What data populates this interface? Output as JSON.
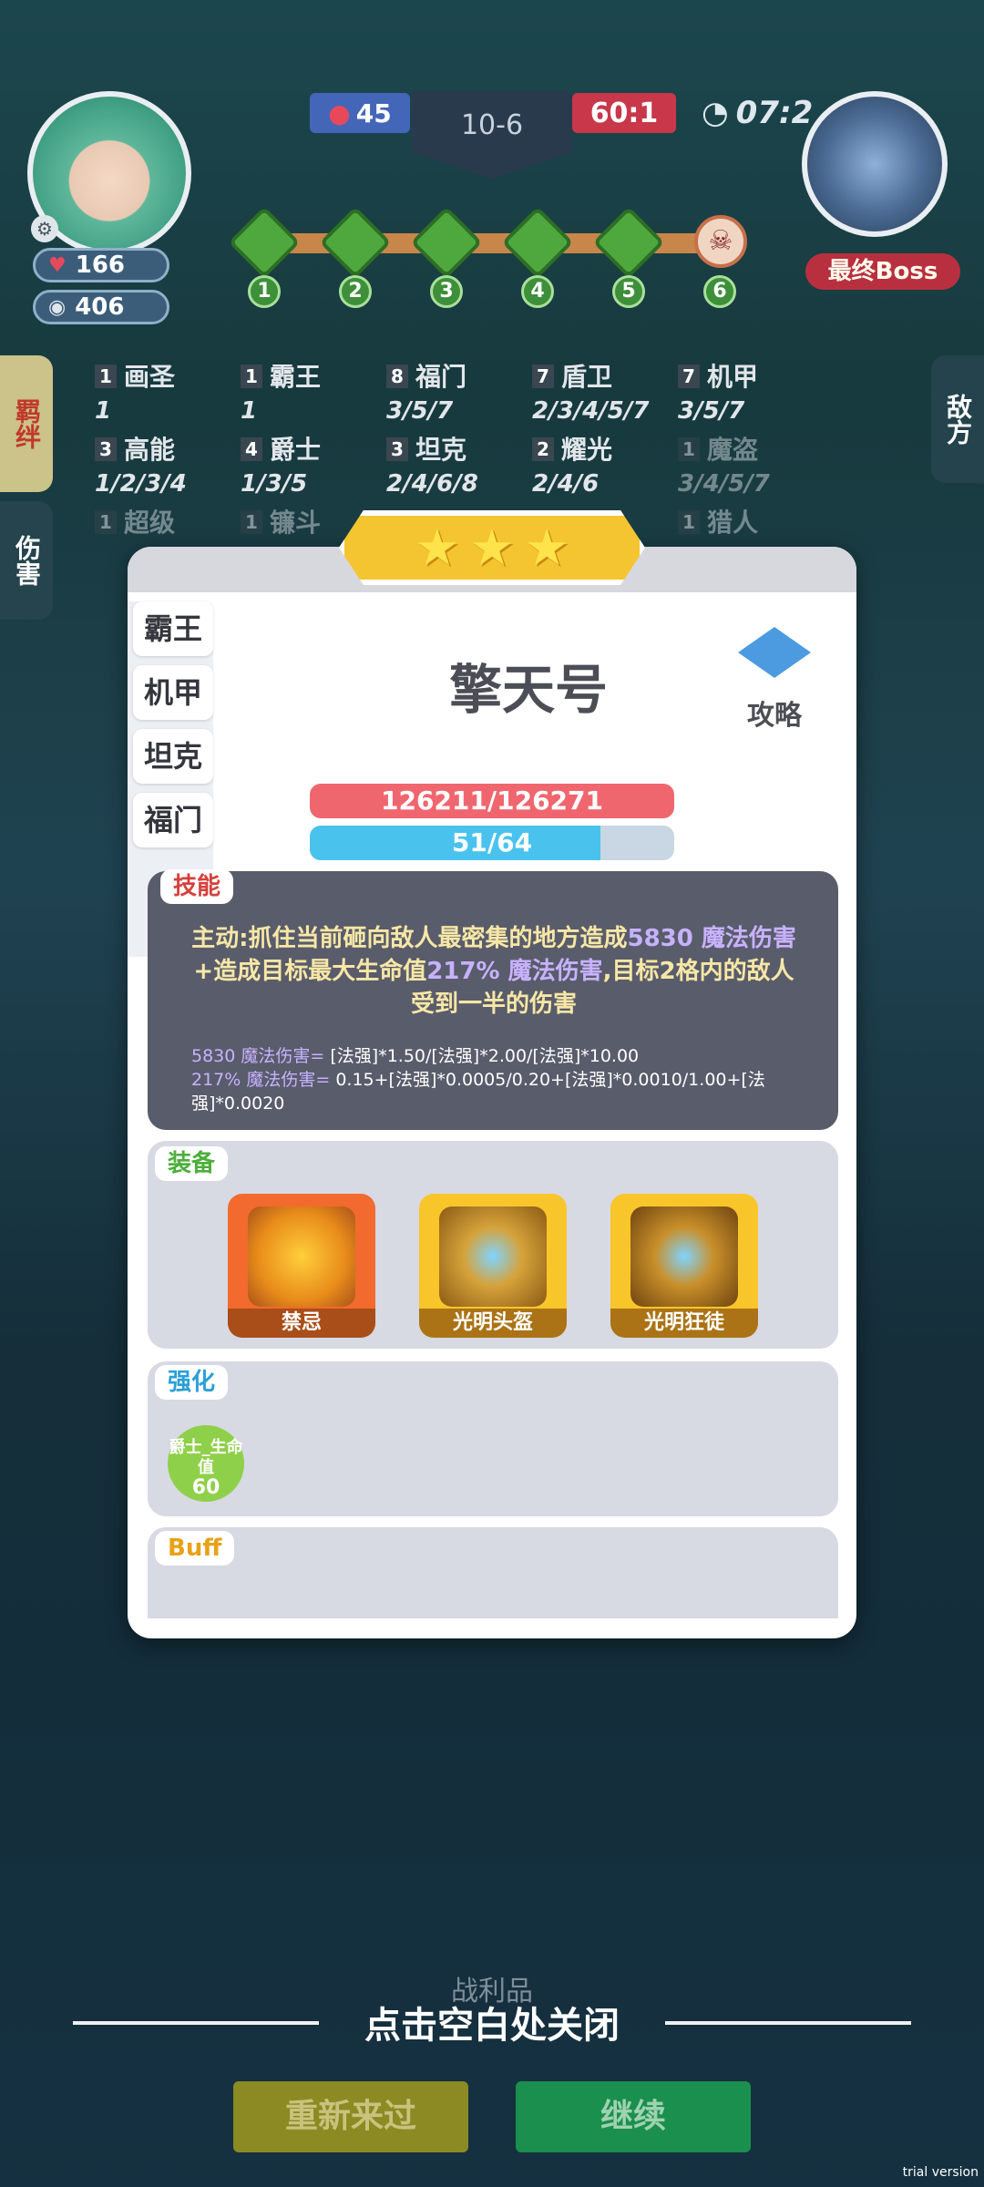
{
  "hud": {
    "hp": "166",
    "coins": "406",
    "score_blue": "45",
    "round": "10-6",
    "score_red": "60:1",
    "timer": "07:2",
    "boss_label": "最终Boss",
    "stages": [
      "1",
      "2",
      "3",
      "4",
      "5",
      "6"
    ]
  },
  "side_tabs": {
    "synergy": "羁绊",
    "damage": "伤害",
    "enemy": "敌方"
  },
  "synergies": [
    {
      "count": "1",
      "name": "画圣",
      "levels": "1"
    },
    {
      "count": "1",
      "name": "霸王",
      "levels": "1"
    },
    {
      "count": "8",
      "name": "福门",
      "levels": "3/5/7"
    },
    {
      "count": "7",
      "name": "盾卫",
      "levels": "2/3/4/5/7"
    },
    {
      "count": "7",
      "name": "机甲",
      "levels": "3/5/7"
    },
    {
      "count": "3",
      "name": "高能",
      "levels": "1/2/3/4"
    },
    {
      "count": "4",
      "name": "爵士",
      "levels": "1/3/5"
    },
    {
      "count": "3",
      "name": "坦克",
      "levels": "2/4/6/8"
    },
    {
      "count": "2",
      "name": "耀光",
      "levels": "2/4/6"
    },
    {
      "count": "1",
      "name": "魔盗",
      "levels": "3/4/5/7"
    },
    {
      "count": "1",
      "name": "超级",
      "levels": ""
    },
    {
      "count": "1",
      "name": "镰斗",
      "levels": ""
    },
    {
      "count": "1",
      "name": "猎人",
      "levels": ""
    }
  ],
  "modal": {
    "unit_tabs": [
      "霸王",
      "机甲",
      "坦克",
      "福门"
    ],
    "unit_name": "擎天号",
    "guide_label": "攻略",
    "hp_text": "126211/126271",
    "mp_text": "51/64",
    "mp_fraction": 0.797,
    "skill_tag": "技能",
    "skill_pre": "主动:抓住当前砸向敌人最密集的地方造成",
    "skill_v1": "5830 魔法伤害",
    "skill_mid": "+造成目标最大生命值",
    "skill_v2": "217% 魔法伤害",
    "skill_post": ",目标2格内的敌人受到一半的伤害",
    "formula1_hl": "5830 魔法伤害=",
    "formula1": " [法强]*1.50/[法强]*2.00/[法强]*10.00",
    "formula2_hl": "217% 魔法伤害=",
    "formula2": " 0.15+[法强]*0.0005/0.20+[法强]*0.0010/1.00+[法强]*0.0020",
    "equip_tag": "装备",
    "equipment": [
      {
        "name": "禁忌",
        "color": "#f26a2e"
      },
      {
        "name": "光明头盔",
        "color": "#f8c62a"
      },
      {
        "name": "光明狂徒",
        "color": "#f8c62a"
      }
    ],
    "enhance_tag": "强化",
    "enhance_label": "爵士_生命值",
    "enhance_value": "60",
    "buff_tag": "Buff"
  },
  "bottom": {
    "loot_label": "战利品",
    "close_hint": "点击空白处关闭",
    "retry": "重新来过",
    "continue": "继续",
    "watermark": "trial version"
  }
}
